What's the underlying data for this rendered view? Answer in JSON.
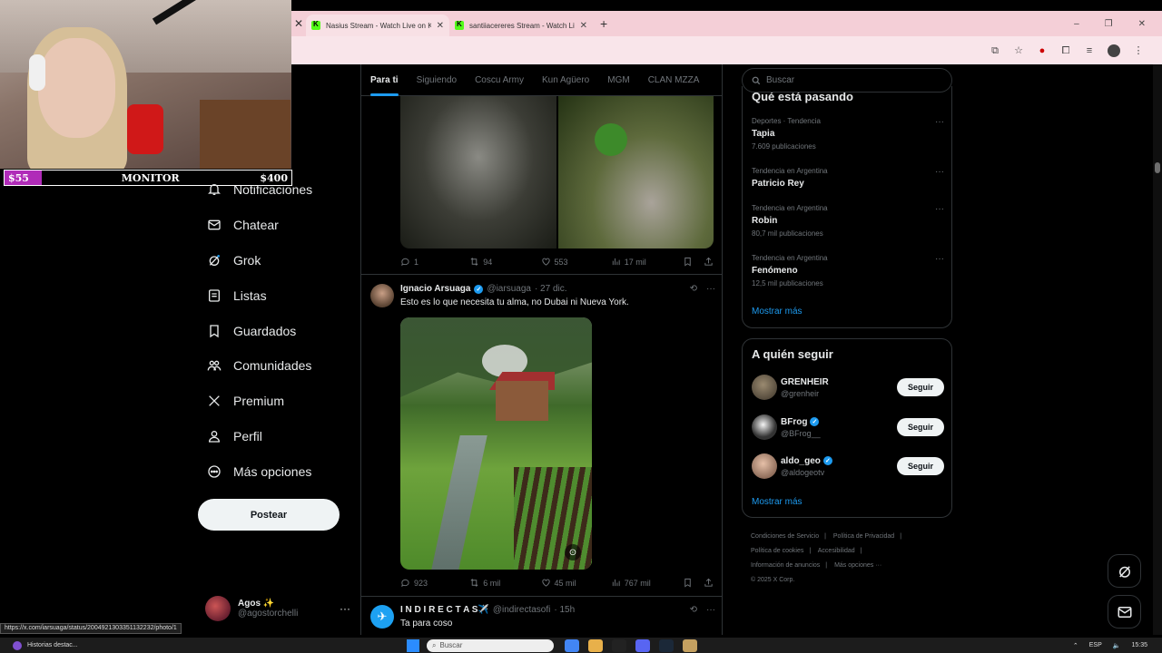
{
  "browser": {
    "tabs": [
      {
        "title": "Nasius Stream - Watch Live on Kick",
        "active": true
      },
      {
        "title": "santiiacereres Stream - Watch Live on Kick",
        "active": false
      }
    ],
    "window_controls": [
      "–",
      "❐",
      "✕"
    ]
  },
  "stream_overlay": {
    "goal_low": "$55",
    "goal_label": "MONITOR",
    "goal_high": "$400",
    "goal_progress": 0.13
  },
  "nav": {
    "items": [
      {
        "label": "Notificaciones",
        "icon": "bell-icon"
      },
      {
        "label": "Chatear",
        "icon": "mail-icon"
      },
      {
        "label": "Grok",
        "icon": "grok-icon"
      },
      {
        "label": "Listas",
        "icon": "list-icon"
      },
      {
        "label": "Guardados",
        "icon": "bookmark-icon"
      },
      {
        "label": "Comunidades",
        "icon": "communities-icon"
      },
      {
        "label": "Premium",
        "icon": "x-logo-icon"
      },
      {
        "label": "Perfil",
        "icon": "person-icon"
      },
      {
        "label": "Más opciones",
        "icon": "more-circle-icon"
      }
    ],
    "post_button": "Postear",
    "account": {
      "name": "Agos ✨",
      "handle": "@agostorchelli"
    }
  },
  "feed": {
    "tabs": [
      "Para ti",
      "Siguiendo",
      "Coscu Army",
      "Kun Agüero",
      "MGM",
      "CLAN MZZA"
    ],
    "active_tab": "Para ti",
    "post1_actions": {
      "replies": "1",
      "reposts": "94",
      "likes": "553",
      "views": "17 mil"
    },
    "post2": {
      "name": "Ignacio Arsuaga",
      "handle": "@iarsuaga",
      "time": "· 27 dic.",
      "text": "Esto es lo que necesita tu alma, no Dubai ni Nueva York.",
      "actions": {
        "replies": "923",
        "reposts": "6 mil",
        "likes": "45 mil",
        "views": "767 mil"
      }
    },
    "post3": {
      "name": "I N D I R E C T A S✈️",
      "handle": "@indirectasofi",
      "time": "· 15h",
      "text": "Ta para coso"
    }
  },
  "sidebar": {
    "search_placeholder": "Buscar",
    "trends_title": "Qué está pasando",
    "trends": [
      {
        "meta": "Deportes · Tendencia",
        "topic": "Tapia",
        "count": "7.609 publicaciones"
      },
      {
        "meta": "Tendencia en Argentina",
        "topic": "Patricio Rey",
        "count": ""
      },
      {
        "meta": "Tendencia en Argentina",
        "topic": "Robin",
        "count": "80,7 mil publicaciones"
      },
      {
        "meta": "Tendencia en Argentina",
        "topic": "Fenómeno",
        "count": "12,5 mil publicaciones"
      }
    ],
    "trends_show_more": "Mostrar más",
    "follow_title": "A quién seguir",
    "follow": [
      {
        "name": "GRENHEIR",
        "handle": "@grenheir",
        "verified": false,
        "button": "Seguir"
      },
      {
        "name": "BFrog",
        "handle": "@BFrog__",
        "verified": true,
        "button": "Seguir"
      },
      {
        "name": "aldo_geo",
        "handle": "@aldogeotv",
        "verified": true,
        "button": "Seguir"
      }
    ],
    "follow_show_more": "Mostrar más",
    "footer": [
      "Condiciones de Servicio",
      "|",
      "Política de Privacidad",
      "|",
      "Política de cookies",
      "|",
      "Accesibilidad",
      "|",
      "Información de anuncios",
      "|",
      "Más opciones ···",
      "© 2025 X Corp."
    ]
  },
  "status_url": "https://x.com/iarsuaga/status/2004921303351132232/photo/1",
  "taskbar": {
    "news": "Historias destac...",
    "search_placeholder": "Buscar",
    "lang": "ESP",
    "time": "15:35"
  },
  "colors": {
    "accent": "#1d9bf0",
    "kick_green": "#53fc18",
    "tabbar": "#f4cfd7",
    "goal_fill": "#b02bb8"
  }
}
